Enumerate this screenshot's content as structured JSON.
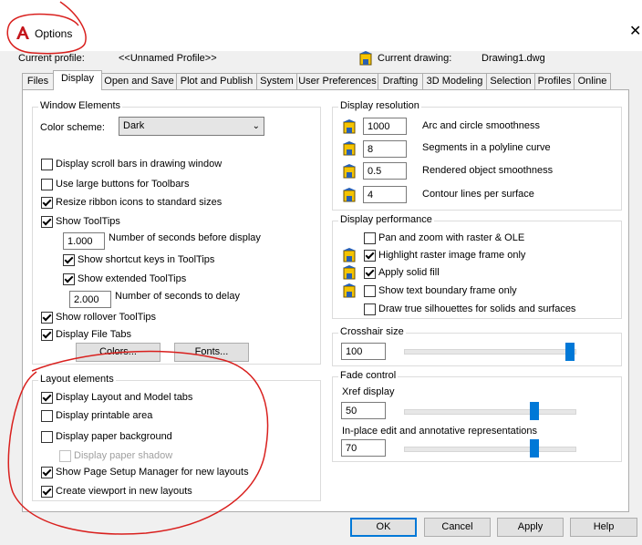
{
  "window": {
    "title": "Options",
    "close_glyph": "✕"
  },
  "profile_bar": {
    "current_profile_label": "Current profile:",
    "current_profile_value": "<<Unnamed Profile>>",
    "current_drawing_label": "Current drawing:",
    "current_drawing_value": "Drawing1.dwg"
  },
  "tabs": [
    {
      "label": "Files"
    },
    {
      "label": "Display",
      "active": true
    },
    {
      "label": "Open and Save"
    },
    {
      "label": "Plot and Publish"
    },
    {
      "label": "System"
    },
    {
      "label": "User Preferences"
    },
    {
      "label": "Drafting"
    },
    {
      "label": "3D Modeling"
    },
    {
      "label": "Selection"
    },
    {
      "label": "Profiles"
    },
    {
      "label": "Online"
    }
  ],
  "window_elements": {
    "title": "Window Elements",
    "color_scheme_label": "Color scheme:",
    "color_scheme_value": "Dark",
    "options": [
      {
        "label": "Display scroll bars in drawing window",
        "checked": false
      },
      {
        "label": "Use large buttons for Toolbars",
        "checked": false
      },
      {
        "label": "Resize ribbon icons to standard sizes",
        "checked": true
      },
      {
        "label": "Show ToolTips",
        "checked": true
      }
    ],
    "tooltip_delay_value": "1.000",
    "tooltip_delay_label": "Number of seconds before display",
    "shortcut_keys": {
      "label": "Show shortcut keys in ToolTips",
      "checked": true
    },
    "extended_tooltips": {
      "label": "Show extended ToolTips",
      "checked": true
    },
    "extended_delay_value": "2.000",
    "extended_delay_label": "Number of seconds to delay",
    "rollover": {
      "label": "Show rollover ToolTips",
      "checked": true
    },
    "file_tabs": {
      "label": "Display File Tabs",
      "checked": true
    },
    "colors_button": "Colors...",
    "fonts_button": "Fonts..."
  },
  "layout_elements": {
    "title": "Layout elements",
    "options": [
      {
        "label": "Display Layout and Model tabs",
        "checked": true,
        "disabled": false
      },
      {
        "label": "Display printable area",
        "checked": false,
        "disabled": false
      },
      {
        "label": "Display paper background",
        "checked": false,
        "disabled": false
      },
      {
        "label": "Display paper shadow",
        "checked": false,
        "disabled": true
      },
      {
        "label": "Show Page Setup Manager for new layouts",
        "checked": true,
        "disabled": false
      },
      {
        "label": "Create viewport in new layouts",
        "checked": true,
        "disabled": false
      }
    ]
  },
  "display_resolution": {
    "title": "Display resolution",
    "items": [
      {
        "value": "1000",
        "label": "Arc and circle smoothness"
      },
      {
        "value": "8",
        "label": "Segments in a polyline curve"
      },
      {
        "value": "0.5",
        "label": "Rendered object smoothness"
      },
      {
        "value": "4",
        "label": "Contour lines per surface"
      }
    ]
  },
  "display_performance": {
    "title": "Display performance",
    "options": [
      {
        "label": "Pan and zoom with raster & OLE",
        "checked": false
      },
      {
        "label": "Highlight raster image frame only",
        "checked": true
      },
      {
        "label": "Apply solid fill",
        "checked": true
      },
      {
        "label": "Show text boundary frame only",
        "checked": false
      },
      {
        "label": "Draw true silhouettes for solids and surfaces",
        "checked": false
      }
    ]
  },
  "crosshair": {
    "title": "Crosshair size",
    "value": "100",
    "level_fraction": 1.0
  },
  "fade_control": {
    "title": "Fade control",
    "xref_label": "Xref display",
    "xref_value": "50",
    "xref_fraction": 0.78,
    "inplace_label": "In-place edit and annotative representations",
    "inplace_value": "70",
    "inplace_fraction": 0.78
  },
  "footer": {
    "ok": "OK",
    "cancel": "Cancel",
    "apply": "Apply",
    "help": "Help"
  },
  "colors": {
    "accent": "#0078d7",
    "annotation_red": "#d9201e",
    "app_icon_red": "#c4161c"
  },
  "icons": [
    "autocad-a-icon",
    "drawing-saved-icon",
    "close-icon",
    "chevron-down-icon"
  ]
}
